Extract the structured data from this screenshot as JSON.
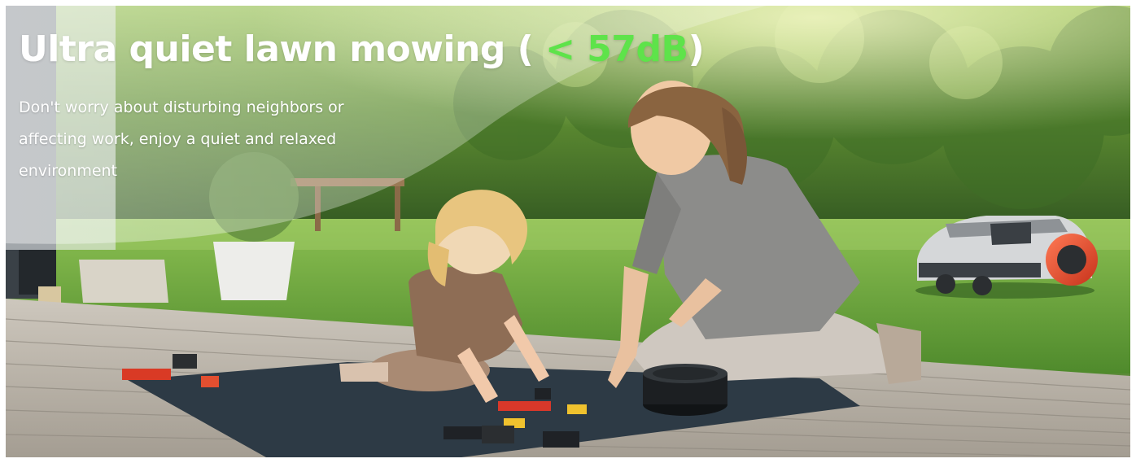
{
  "hero": {
    "headline_prefix": "Ultra quiet lawn mowing (",
    "headline_accent": " <  57dB",
    "headline_suffix": ")",
    "description": "Don't worry about disturbing neighbors or affecting work, enjoy a quiet and relaxed environment"
  },
  "colors": {
    "accent_green": "#5ee34a",
    "text_white": "#ffffff",
    "lawn_green": "#6aa23c",
    "deck_grey": "#b9b3a9",
    "mat_blue": "#2d3a45"
  },
  "icons": {
    "robot_mower": "robot-mower-icon",
    "charging_base": "charging-base-icon"
  }
}
